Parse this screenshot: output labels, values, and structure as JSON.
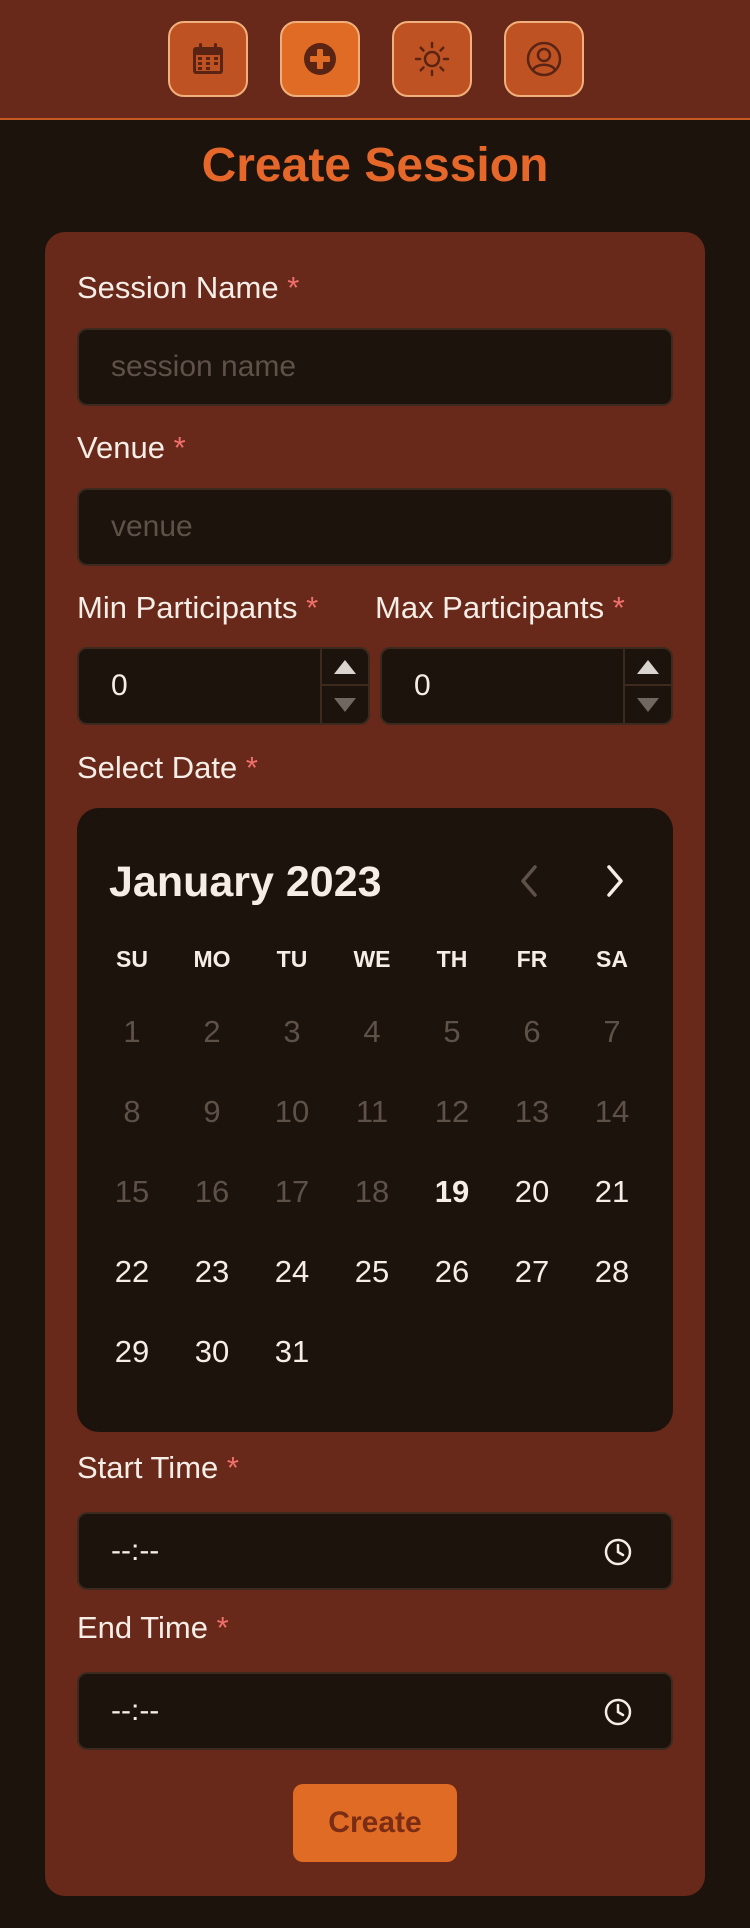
{
  "nav": {
    "items": [
      {
        "name": "calendar",
        "active": false
      },
      {
        "name": "add",
        "active": true
      },
      {
        "name": "theme",
        "active": false
      },
      {
        "name": "profile",
        "active": false
      }
    ]
  },
  "page": {
    "title": "Create Session"
  },
  "form": {
    "session_name": {
      "label": "Session Name",
      "required_mark": "*",
      "placeholder": "session name",
      "value": ""
    },
    "venue": {
      "label": "Venue",
      "required_mark": "*",
      "placeholder": "venue",
      "value": ""
    },
    "min_participants": {
      "label": "Min Participants",
      "required_mark": "*",
      "value": "0"
    },
    "max_participants": {
      "label": "Max Participants",
      "required_mark": "*",
      "value": "0"
    },
    "date": {
      "label": "Select Date",
      "required_mark": "*"
    },
    "start_time": {
      "label": "Start Time",
      "required_mark": "*",
      "value": "--:--"
    },
    "end_time": {
      "label": "End Time",
      "required_mark": "*",
      "value": "--:--"
    },
    "submit_label": "Create"
  },
  "calendar": {
    "month_label": "January 2023",
    "weekdays": [
      "SU",
      "MO",
      "TU",
      "WE",
      "TH",
      "FR",
      "SA"
    ],
    "days": [
      "1",
      "2",
      "3",
      "4",
      "5",
      "6",
      "7",
      "8",
      "9",
      "10",
      "11",
      "12",
      "13",
      "14",
      "15",
      "16",
      "17",
      "18",
      "19",
      "20",
      "21",
      "22",
      "23",
      "24",
      "25",
      "26",
      "27",
      "28",
      "29",
      "30",
      "31"
    ],
    "first_weekday_index": 0,
    "today": "19",
    "disabled_before": "19",
    "prev_disabled": true
  },
  "colors": {
    "topbar_bg": "#69291a",
    "accent": "#e06b25",
    "page_bg": "#1c130d",
    "required": "#f0706b"
  }
}
